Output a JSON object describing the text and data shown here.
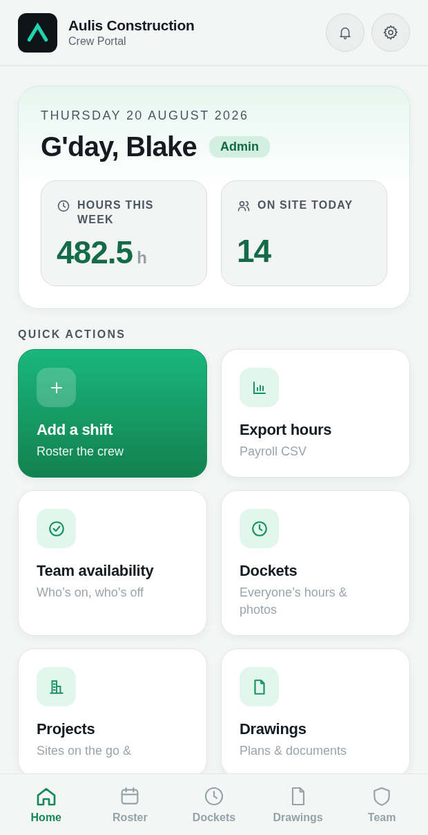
{
  "header": {
    "title": "Aulis Construction",
    "subtitle": "Crew Portal"
  },
  "hero": {
    "date": "THURSDAY 20 AUGUST 2026",
    "greeting": "G'day, Blake",
    "role": "Admin",
    "stats": [
      {
        "label": "HOURS THIS WEEK",
        "value": "482.5",
        "unit": "h"
      },
      {
        "label": "ON SITE TODAY",
        "value": "14"
      }
    ]
  },
  "quick_actions": {
    "title": "QUICK ACTIONS",
    "items": [
      {
        "kind": "primary",
        "title": "Add a shift",
        "subtitle": "Roster the crew"
      },
      {
        "kind": "plain",
        "title": "Export hours",
        "subtitle": "Payroll CSV"
      },
      {
        "kind": "plain",
        "title": "Team availability",
        "subtitle": "Who’s on, who’s off"
      },
      {
        "kind": "plain",
        "title": "Dockets",
        "subtitle": "Everyone’s hours & photos"
      },
      {
        "kind": "plain",
        "title": "Projects",
        "subtitle": "Sites on the go &"
      },
      {
        "kind": "plain",
        "title": "Drawings",
        "subtitle": "Plans & documents"
      }
    ]
  },
  "nav": [
    {
      "label": "Home",
      "selected": true
    },
    {
      "label": "Roster",
      "selected": false
    },
    {
      "label": "Dockets",
      "selected": false
    },
    {
      "label": "Drawings",
      "selected": false
    },
    {
      "label": "Team",
      "selected": false
    }
  ]
}
